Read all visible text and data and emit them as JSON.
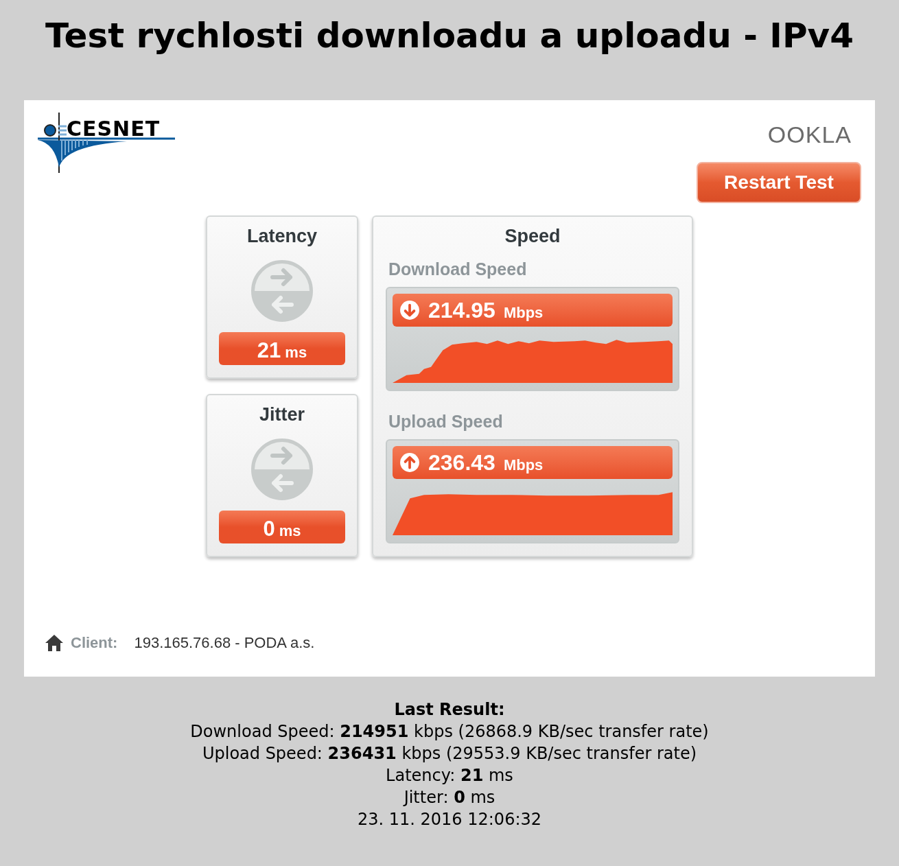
{
  "page_title": "Test rychlosti downloadu a uploadu - IPv4",
  "header": {
    "cesnet_logo": "CESNET",
    "ookla_logo": "OOKLA",
    "restart_button": "Restart Test"
  },
  "metrics": [
    {
      "title": "Latency",
      "value": "21",
      "unit": "ms"
    },
    {
      "title": "Jitter",
      "value": "0",
      "unit": "ms"
    }
  ],
  "speed": {
    "title": "Speed",
    "tests": [
      {
        "kind": "download",
        "label": "Download Speed",
        "value": "214.95",
        "unit": "Mbps"
      },
      {
        "kind": "upload",
        "label": "Upload Speed",
        "value": "236.43",
        "unit": "Mbps"
      }
    ]
  },
  "client": {
    "label": "Client:",
    "value": "193.165.76.68 - PODA a.s."
  },
  "last_result": {
    "title": "Last Result:",
    "lines": [
      "Download Speed: **214951** kbps (26868.9 KB/sec transfer rate)",
      "Upload Speed: **236431** kbps (29553.9 KB/sec transfer rate)",
      "Latency: **21** ms",
      "Jitter: **0** ms",
      "23. 11. 2016 12:06:32"
    ]
  }
}
